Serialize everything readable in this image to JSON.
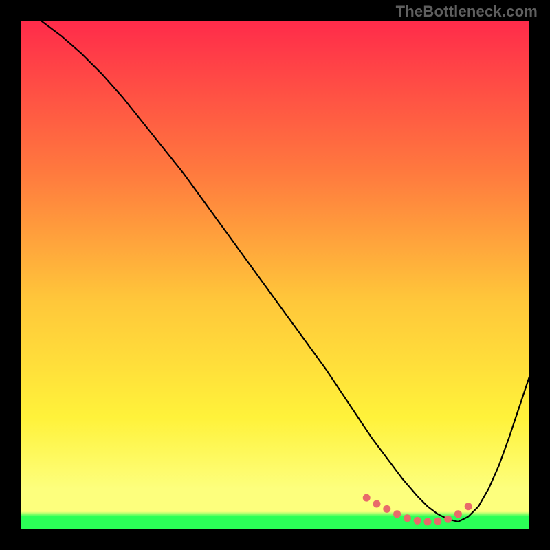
{
  "watermark": "TheBottleneck.com",
  "colors": {
    "gradient_top": "#ff2b4a",
    "gradient_mid_upper": "#ff7a3e",
    "gradient_mid": "#ffc73a",
    "gradient_mid_lower": "#fff23a",
    "gradient_low": "#fdff7d",
    "gradient_green": "#2bff57",
    "curve": "#000000",
    "marker": "#e86a6a",
    "frame": "#000000"
  },
  "chart_data": {
    "type": "line",
    "title": "",
    "xlabel": "",
    "ylabel": "",
    "xlim": [
      0,
      100
    ],
    "ylim": [
      0,
      100
    ],
    "series": [
      {
        "name": "bottleneck-curve",
        "x": [
          4,
          8,
          12,
          16,
          20,
          24,
          28,
          32,
          36,
          40,
          44,
          48,
          52,
          56,
          60,
          63,
          66,
          69,
          72,
          75,
          78,
          80,
          82,
          84,
          86,
          88,
          90,
          92,
          94,
          96,
          98,
          100
        ],
        "y": [
          100,
          97,
          93.5,
          89.5,
          85,
          80,
          75,
          70,
          64.5,
          59,
          53.5,
          48,
          42.5,
          37,
          31.5,
          27,
          22.5,
          18,
          14,
          10,
          6.5,
          4.5,
          3,
          2,
          1.5,
          2.5,
          4.5,
          8,
          12.5,
          18,
          24,
          30
        ]
      }
    ],
    "optimal_markers": {
      "name": "optimal-range",
      "x": [
        68,
        70,
        72,
        74,
        76,
        78,
        80,
        82,
        84,
        86,
        88
      ],
      "y": [
        6.2,
        5.0,
        4.0,
        3.0,
        2.2,
        1.7,
        1.5,
        1.6,
        2.0,
        3.0,
        4.5
      ]
    }
  }
}
